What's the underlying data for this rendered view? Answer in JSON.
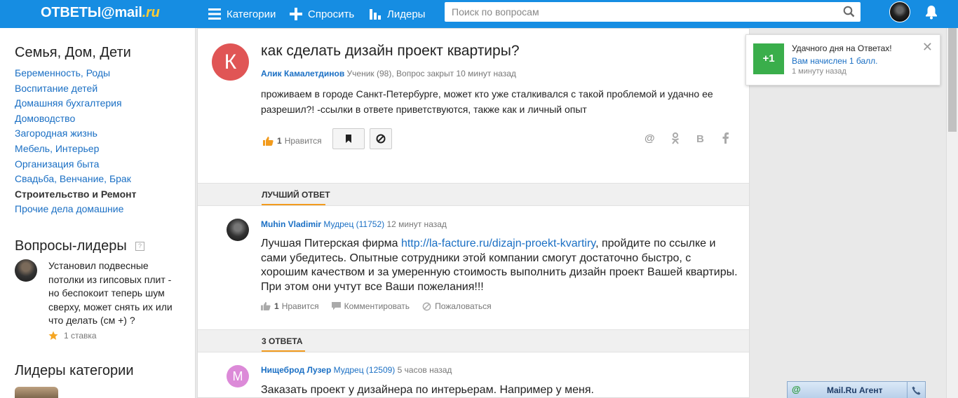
{
  "header": {
    "logo_main": "ОТВЕТЫ@mail",
    "logo_suffix": ".ru",
    "nav": [
      "Категории",
      "Спросить",
      "Лидеры"
    ],
    "search_placeholder": "Поиск по вопросам"
  },
  "sidebar": {
    "category_heading": "Семья, Дом, Дети",
    "categories": [
      "Беременность, Роды",
      "Воспитание детей",
      "Домашняя бухгалтерия",
      "Домоводство",
      "Загородная жизнь",
      "Мебель, Интерьер",
      "Организация быта",
      "Свадьба, Венчание, Брак",
      "Строительство и Ремонт",
      "Прочие дела домашние"
    ],
    "active_category": "Строительство и Ремонт",
    "leader_questions_heading": "Вопросы-лидеры",
    "leader_question_text": "Установил подвесные потолки из гипсовых плит - но беспокоит теперь шум сверху, может снять их или что делать (см +) ?",
    "leader_question_meta": "1 ставка",
    "category_leaders_heading": "Лидеры категории"
  },
  "question": {
    "avatar_letter": "К",
    "title": "как сделать дизайн проект квартиры?",
    "author": "Алик Камалетдинов",
    "meta": "Ученик (98), Вопрос закрыт 10 минут назад",
    "body": "проживаем в городе Санкт-Петербурге, может кто уже сталкивался с такой проблемой и удачно ее разрешил?! -ссылки в ответе приветствуются, также как и личный опыт",
    "likes": "1",
    "like_label": "Нравится"
  },
  "best_answer": {
    "section_label": "Лучший ответ",
    "author": "Muhin Vladimir",
    "rank": "Мудрец (11752)",
    "time": "12 минут назад",
    "body_before": "Лучшая Питерская фирма ",
    "link": "http://la-facture.ru/dizajn-proekt-kvartiry",
    "body_after": ", пройдите по ссылке и сами убедитесь. Опытные сотрудники этой компании смогут достаточно быстро, с хорошим качеством и за умеренную стоимость выполнить дизайн проект Вашей квартиры. При этом они учтут все Ваши пожелания!!!",
    "likes": "1",
    "like_label": "Нравится",
    "comment_label": "Комментировать",
    "report_label": "Пожаловаться"
  },
  "answers": {
    "section_label": "3 ответа",
    "first": {
      "avatar_letter": "М",
      "author": "Нищеброд Лузер",
      "rank": "Мудрец (12509)",
      "time": "5 часов назад",
      "body": "Заказать проект у дизайнера по интерьерам. Например у меня."
    }
  },
  "toast": {
    "badge": "+1",
    "title": "Удачного дня на Ответах!",
    "link": "Вам начислен 1 балл.",
    "time": "1 минуту назад"
  },
  "agent": {
    "icon": "@",
    "label": "Mail.Ru Агент"
  },
  "colors": {
    "header_blue": "#168de2",
    "link_blue": "#1a6fc4",
    "accent_orange": "#f29b1d",
    "toast_green": "#3aae4b",
    "question_avatar": "#e05555",
    "answer_avatar": "#dc8ad8"
  }
}
